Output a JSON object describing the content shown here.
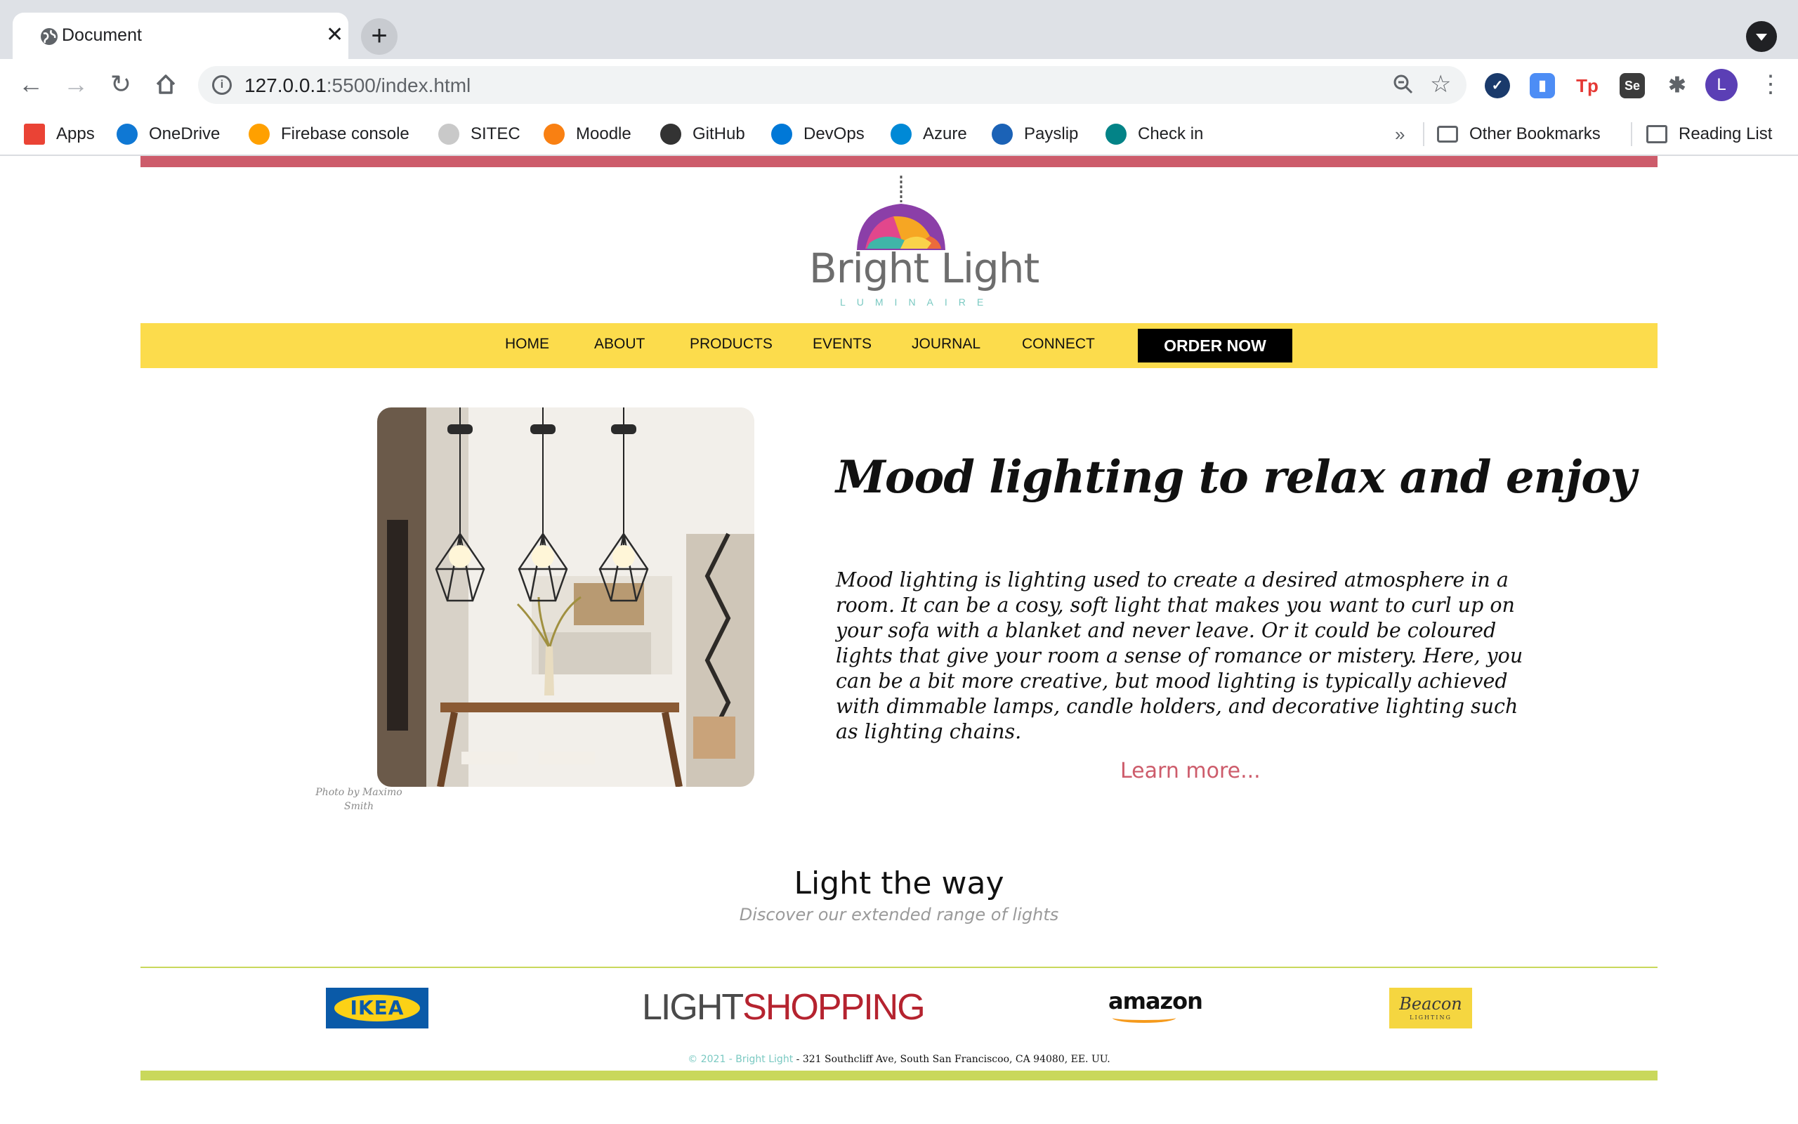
{
  "browser": {
    "tab_title": "Document",
    "tab_close": "✕",
    "new_tab": "+",
    "url_host": "127.0.0.1",
    "url_rest": ":5500/index.html",
    "profile_initial": "L",
    "bookmarks": [
      {
        "label": "Apps",
        "icon": "apps-grid-icon",
        "color": "#ea4335"
      },
      {
        "label": "OneDrive",
        "icon": "onedrive-icon",
        "color": "#0f78d4"
      },
      {
        "label": "Firebase console",
        "icon": "firebase-icon",
        "color": "#ffa000"
      },
      {
        "label": "SITEC",
        "icon": "sitec-icon",
        "color": "#c9c9c9"
      },
      {
        "label": "Moodle",
        "icon": "moodle-icon",
        "color": "#f98012"
      },
      {
        "label": "GitHub",
        "icon": "github-icon",
        "color": "#333333"
      },
      {
        "label": "DevOps",
        "icon": "devops-icon",
        "color": "#0078d7"
      },
      {
        "label": "Azure",
        "icon": "azure-icon",
        "color": "#0089d6"
      },
      {
        "label": "Payslip",
        "icon": "sap-icon",
        "color": "#1b62b6"
      },
      {
        "label": "Check in",
        "icon": "sharepoint-icon",
        "color": "#038387"
      }
    ],
    "overflow": "»",
    "other_bookmarks": "Other Bookmarks",
    "reading_list": "Reading List"
  },
  "site": {
    "brand_name": "Bright Light",
    "brand_sub": "LUMINAIRE",
    "nav": [
      "HOME",
      "ABOUT",
      "PRODUCTS",
      "EVENTS",
      "JOURNAL",
      "CONNECT"
    ],
    "order_button": "ORDER NOW",
    "hero": {
      "photo_caption": "Photo by Maximo Smith",
      "title": "Mood lighting to relax and enjoy",
      "text": "Mood lighting is lighting used to create a desired atmosphere in a room. It can be a cosy, soft light that makes you want to curl up on your sofa with a blanket and never leave. Or it could be coloured lights that give your room a sense of romance or mistery. Here, you can be a bit more creative, but mood lighting is typically achieved with dimmable lamps, candle holders, and decorative lighting such as lighting chains.",
      "learn_more": "Learn more..."
    },
    "section": {
      "title": "Light the way",
      "subtitle": "Discover our extended range of lights"
    },
    "partners": {
      "ikea": "IKEA",
      "lightshopping_a": "LIGHT",
      "lightshopping_b": "SHOPPING",
      "amazon": "amazon",
      "beacon": "Beacon",
      "beacon_sub": "LIGHTING"
    },
    "footer": {
      "copyright": "© 2021 - Bright Light",
      "address": " - 321 Southcliff Ave, South San Franciscoo, CA 94080, EE. UU."
    },
    "colors": {
      "accent_red": "#cd5c6b",
      "nav_yellow": "#fcdc4c",
      "accent_green": "#c9d85b",
      "teal": "#7ac9c2"
    }
  }
}
